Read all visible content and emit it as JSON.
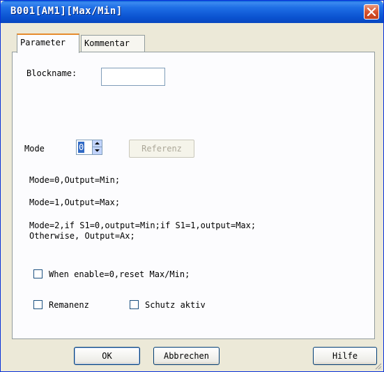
{
  "window": {
    "title": "B001[AM1][Max/Min]"
  },
  "tabs": [
    {
      "label": "Parameter"
    },
    {
      "label": "Kommentar"
    }
  ],
  "form": {
    "blockname_label": "Blockname:",
    "blockname_value": "",
    "mode_label": "Mode",
    "mode_value": "0",
    "referenz_label": "Referenz"
  },
  "descriptions": {
    "line1": "Mode=0,Output=Min;",
    "line2": "Mode=1,Output=Max;",
    "line3a": "Mode=2,if S1=0,output=Min;if S1=1,output=Max;",
    "line3b": "Otherwise, Output=Ax;"
  },
  "checkboxes": {
    "reset_label": "When enable=0,reset Max/Min;",
    "remanenz_label": "Remanenz",
    "schutz_label": "Schutz aktiv"
  },
  "buttons": {
    "ok": "OK",
    "cancel": "Abbrechen",
    "help": "Hilfe"
  },
  "icons": {
    "close": "close-icon",
    "spin_up": "chevron-up-icon",
    "spin_down": "chevron-down-icon",
    "resize": "resize-grip-icon"
  }
}
